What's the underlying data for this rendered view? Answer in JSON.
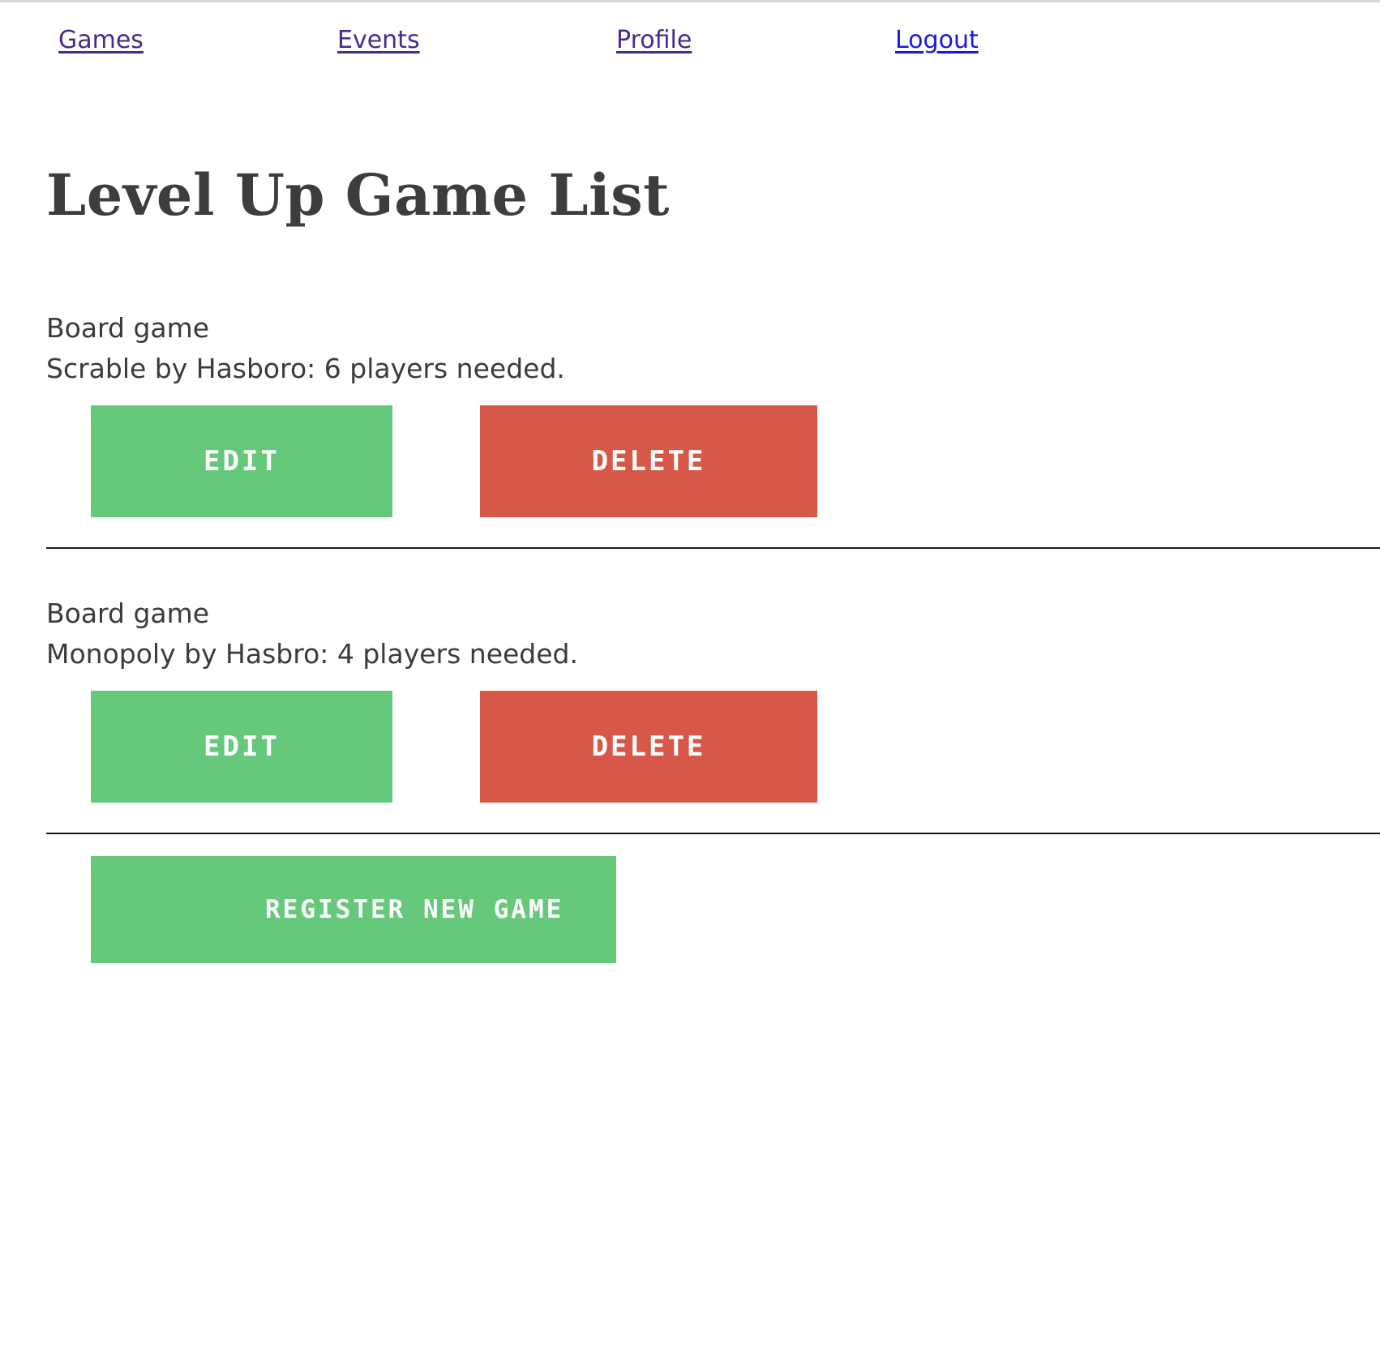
{
  "nav": {
    "items": [
      {
        "label": "Games"
      },
      {
        "label": "Events"
      },
      {
        "label": "Profile"
      },
      {
        "label": "Logout"
      }
    ]
  },
  "page": {
    "title": "Level Up Game List"
  },
  "games": [
    {
      "category": "Board game",
      "description": "Scrable by Hasboro: 6 players needed.",
      "edit_label": "EDIT",
      "delete_label": "DELETE"
    },
    {
      "category": "Board game",
      "description": "Monopoly by Hasbro: 4 players needed.",
      "edit_label": "EDIT",
      "delete_label": "DELETE"
    }
  ],
  "actions": {
    "register_label": "REGISTER NEW GAME"
  },
  "colors": {
    "edit_button": "#66c87b",
    "delete_button": "#d75848",
    "register_button": "#66c87b",
    "heading": "#3d3d3d",
    "visited_link": "#4a2a8c",
    "link": "#1a1ad6"
  }
}
